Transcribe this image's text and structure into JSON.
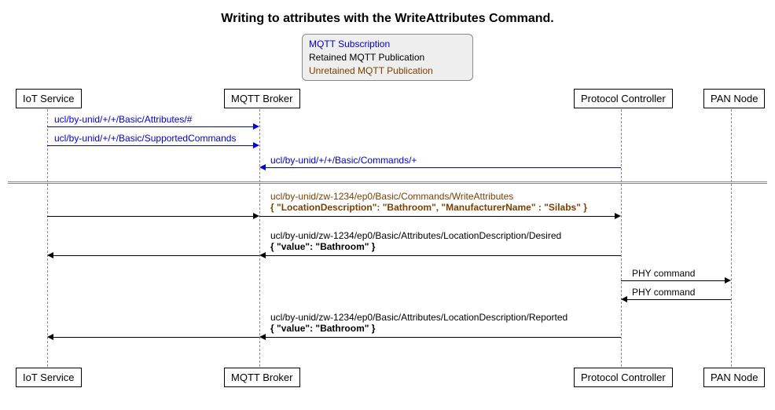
{
  "title": "Writing to attributes with the WriteAttributes Command.",
  "legend": {
    "subscription": "MQTT Subscription",
    "retained": "Retained MQTT Publication",
    "unretained": "Unretained MQTT Publication"
  },
  "participants": {
    "iot": "IoT Service",
    "broker": "MQTT Broker",
    "controller": "Protocol Controller",
    "node": "PAN Node"
  },
  "messages": {
    "m1": {
      "label": "ucl/by-unid/+/+/Basic/Attributes/#"
    },
    "m2": {
      "label": "ucl/by-unid/+/+/Basic/SupportedCommands"
    },
    "m3": {
      "label": "ucl/by-unid/+/+/Basic/Commands/+"
    },
    "m4": {
      "label": "ucl/by-unid/zw-1234/ep0/Basic/Commands/WriteAttributes",
      "payload": "{ \"LocationDescription\": \"Bathroom\", \"ManufacturerName\" : \"Silabs\" }"
    },
    "m5": {
      "label": "ucl/by-unid/zw-1234/ep0/Basic/Attributes/LocationDescription/Desired",
      "payload": "{ \"value\": \"Bathroom\" }"
    },
    "m6": {
      "label": "PHY command"
    },
    "m7": {
      "label": "PHY command"
    },
    "m8": {
      "label": "ucl/by-unid/zw-1234/ep0/Basic/Attributes/LocationDescription/Reported",
      "payload": "{ \"value\": \"Bathroom\" }"
    }
  },
  "chart_data": {
    "type": "sequence-diagram",
    "participants": [
      "IoT Service",
      "MQTT Broker",
      "Protocol Controller",
      "PAN Node"
    ],
    "legend": {
      "subscription_color": "#0000cd",
      "retained_color": "#000000",
      "unretained_color": "#7b3f00"
    },
    "messages": [
      {
        "from": "IoT Service",
        "to": "MQTT Broker",
        "kind": "subscription",
        "text": "ucl/by-unid/+/+/Basic/Attributes/#"
      },
      {
        "from": "IoT Service",
        "to": "MQTT Broker",
        "kind": "subscription",
        "text": "ucl/by-unid/+/+/Basic/SupportedCommands"
      },
      {
        "from": "Protocol Controller",
        "to": "MQTT Broker",
        "kind": "subscription",
        "text": "ucl/by-unid/+/+/Basic/Commands/+"
      },
      {
        "divider": true
      },
      {
        "from": "IoT Service",
        "to": "Protocol Controller",
        "via": "MQTT Broker",
        "kind": "unretained",
        "text": "ucl/by-unid/zw-1234/ep0/Basic/Commands/WriteAttributes",
        "payload": "{ \"LocationDescription\": \"Bathroom\", \"ManufacturerName\" : \"Silabs\" }"
      },
      {
        "from": "Protocol Controller",
        "to": "IoT Service",
        "via": "MQTT Broker",
        "kind": "retained",
        "text": "ucl/by-unid/zw-1234/ep0/Basic/Attributes/LocationDescription/Desired",
        "payload": "{ \"value\": \"Bathroom\" }"
      },
      {
        "from": "Protocol Controller",
        "to": "PAN Node",
        "kind": "phy",
        "text": "PHY command"
      },
      {
        "from": "PAN Node",
        "to": "Protocol Controller",
        "kind": "phy",
        "text": "PHY command"
      },
      {
        "from": "Protocol Controller",
        "to": "IoT Service",
        "via": "MQTT Broker",
        "kind": "retained",
        "text": "ucl/by-unid/zw-1234/ep0/Basic/Attributes/LocationDescription/Reported",
        "payload": "{ \"value\": \"Bathroom\" }"
      }
    ]
  }
}
